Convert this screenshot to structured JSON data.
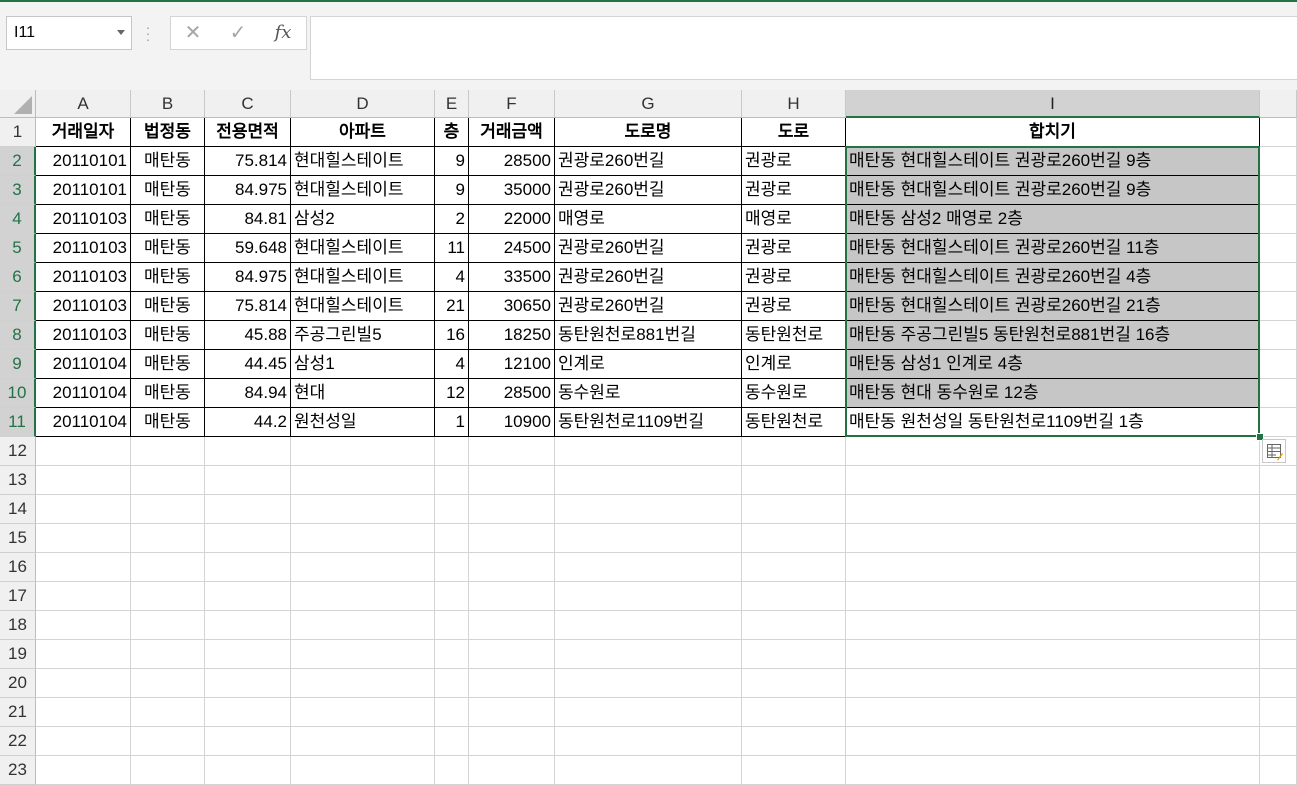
{
  "name_box": {
    "value": "I11"
  },
  "formula_bar": {
    "value": ""
  },
  "icons": {
    "cancel": "✕",
    "enter": "✓",
    "fx": "fx",
    "separator": "⋮"
  },
  "columns": [
    "A",
    "B",
    "C",
    "D",
    "E",
    "F",
    "G",
    "H",
    "I"
  ],
  "selected_column": "I",
  "rows": [
    [
      "거래일자",
      "법정동",
      "전용면적",
      "아파트",
      "층",
      "거래금액",
      "도로명",
      "도로",
      "합치기"
    ],
    [
      "20110101",
      "매탄동",
      "75.814",
      "현대힐스테이트",
      "9",
      "28500",
      "권광로260번길",
      "권광로",
      "매탄동 현대힐스테이트 권광로260번길 9층"
    ],
    [
      "20110101",
      "매탄동",
      "84.975",
      "현대힐스테이트",
      "9",
      "35000",
      "권광로260번길",
      "권광로",
      "매탄동 현대힐스테이트 권광로260번길 9층"
    ],
    [
      "20110103",
      "매탄동",
      "84.81",
      "삼성2",
      "2",
      "22000",
      "매영로",
      "매영로",
      "매탄동 삼성2 매영로 2층"
    ],
    [
      "20110103",
      "매탄동",
      "59.648",
      "현대힐스테이트",
      "11",
      "24500",
      "권광로260번길",
      "권광로",
      "매탄동 현대힐스테이트 권광로260번길 11층"
    ],
    [
      "20110103",
      "매탄동",
      "84.975",
      "현대힐스테이트",
      "4",
      "33500",
      "권광로260번길",
      "권광로",
      "매탄동 현대힐스테이트 권광로260번길 4층"
    ],
    [
      "20110103",
      "매탄동",
      "75.814",
      "현대힐스테이트",
      "21",
      "30650",
      "권광로260번길",
      "권광로",
      "매탄동 현대힐스테이트 권광로260번길 21층"
    ],
    [
      "20110103",
      "매탄동",
      "45.88",
      "주공그린빌5",
      "16",
      "18250",
      "동탄원천로881번길",
      "동탄원천로",
      "매탄동 주공그린빌5 동탄원천로881번길 16층"
    ],
    [
      "20110104",
      "매탄동",
      "44.45",
      "삼성1",
      "4",
      "12100",
      "인계로",
      "인계로",
      "매탄동 삼성1 인계로 4층"
    ],
    [
      "20110104",
      "매탄동",
      "84.94",
      "현대",
      "12",
      "28500",
      "동수원로",
      "동수원로",
      "매탄동 현대 동수원로 12층"
    ],
    [
      "20110104",
      "매탄동",
      "44.2",
      "원천성일",
      "1",
      "10900",
      "동탄원천로1109번길",
      "동탄원천로",
      "매탄동 원천성일 동탄원천로1109번길 1층"
    ]
  ],
  "row_numbers": [
    "1",
    "2",
    "3",
    "4",
    "5",
    "6",
    "7",
    "8",
    "9",
    "10",
    "11",
    "12",
    "13",
    "14",
    "15",
    "16",
    "17",
    "18",
    "19",
    "20",
    "21",
    "22",
    "23"
  ],
  "selected_rows": [
    "2",
    "3",
    "4",
    "5",
    "6",
    "7",
    "8",
    "9",
    "10",
    "11"
  ],
  "colors": {
    "accent": "#217346",
    "selection_fill": "#c6c6c6"
  }
}
